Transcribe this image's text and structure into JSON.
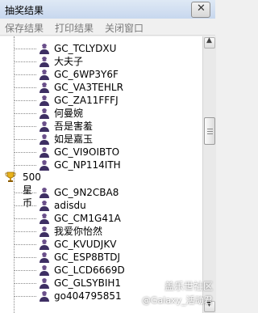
{
  "window": {
    "title": "抽奖结果",
    "close_glyph": "✕"
  },
  "menu": {
    "items": [
      "保存结果",
      "打印结果",
      "关闭窗口"
    ]
  },
  "tree": {
    "rows_before": [
      "GC_TCLYDXU",
      "大夫子",
      "GC_6WP3Y6F",
      "GC_VA3TEHLR",
      "GC_ZA11FFFJ",
      "何曼婉",
      "吾是害羞",
      "如是嘉玉",
      "GC_VI9OIBTO",
      "GC_NP114ITH"
    ],
    "group_label": "500星币",
    "rows_after": [
      "GC_9N2CBA8",
      "adisdu",
      "GC_CM1G41A",
      "我爱你怡然",
      "GC_KVUDJKV",
      "GC_ESP8BTDJ",
      "GC_LCD6669D",
      "GC_GLSYBIH1",
      "go404795851"
    ]
  },
  "scrollbar": {
    "up_glyph": "▲",
    "down_glyph": "▼"
  },
  "watermark": {
    "line1": "盖乐世社区",
    "line2": "@Galaxy_活动君"
  },
  "colors": {
    "titlebar": "#c7d7ee",
    "menu_text": "#7a7a7a",
    "list_bg": "#ffffff"
  },
  "icons": [
    "user-icon",
    "trophy-icon",
    "close-icon",
    "scroll-up-icon",
    "scroll-down-icon"
  ]
}
